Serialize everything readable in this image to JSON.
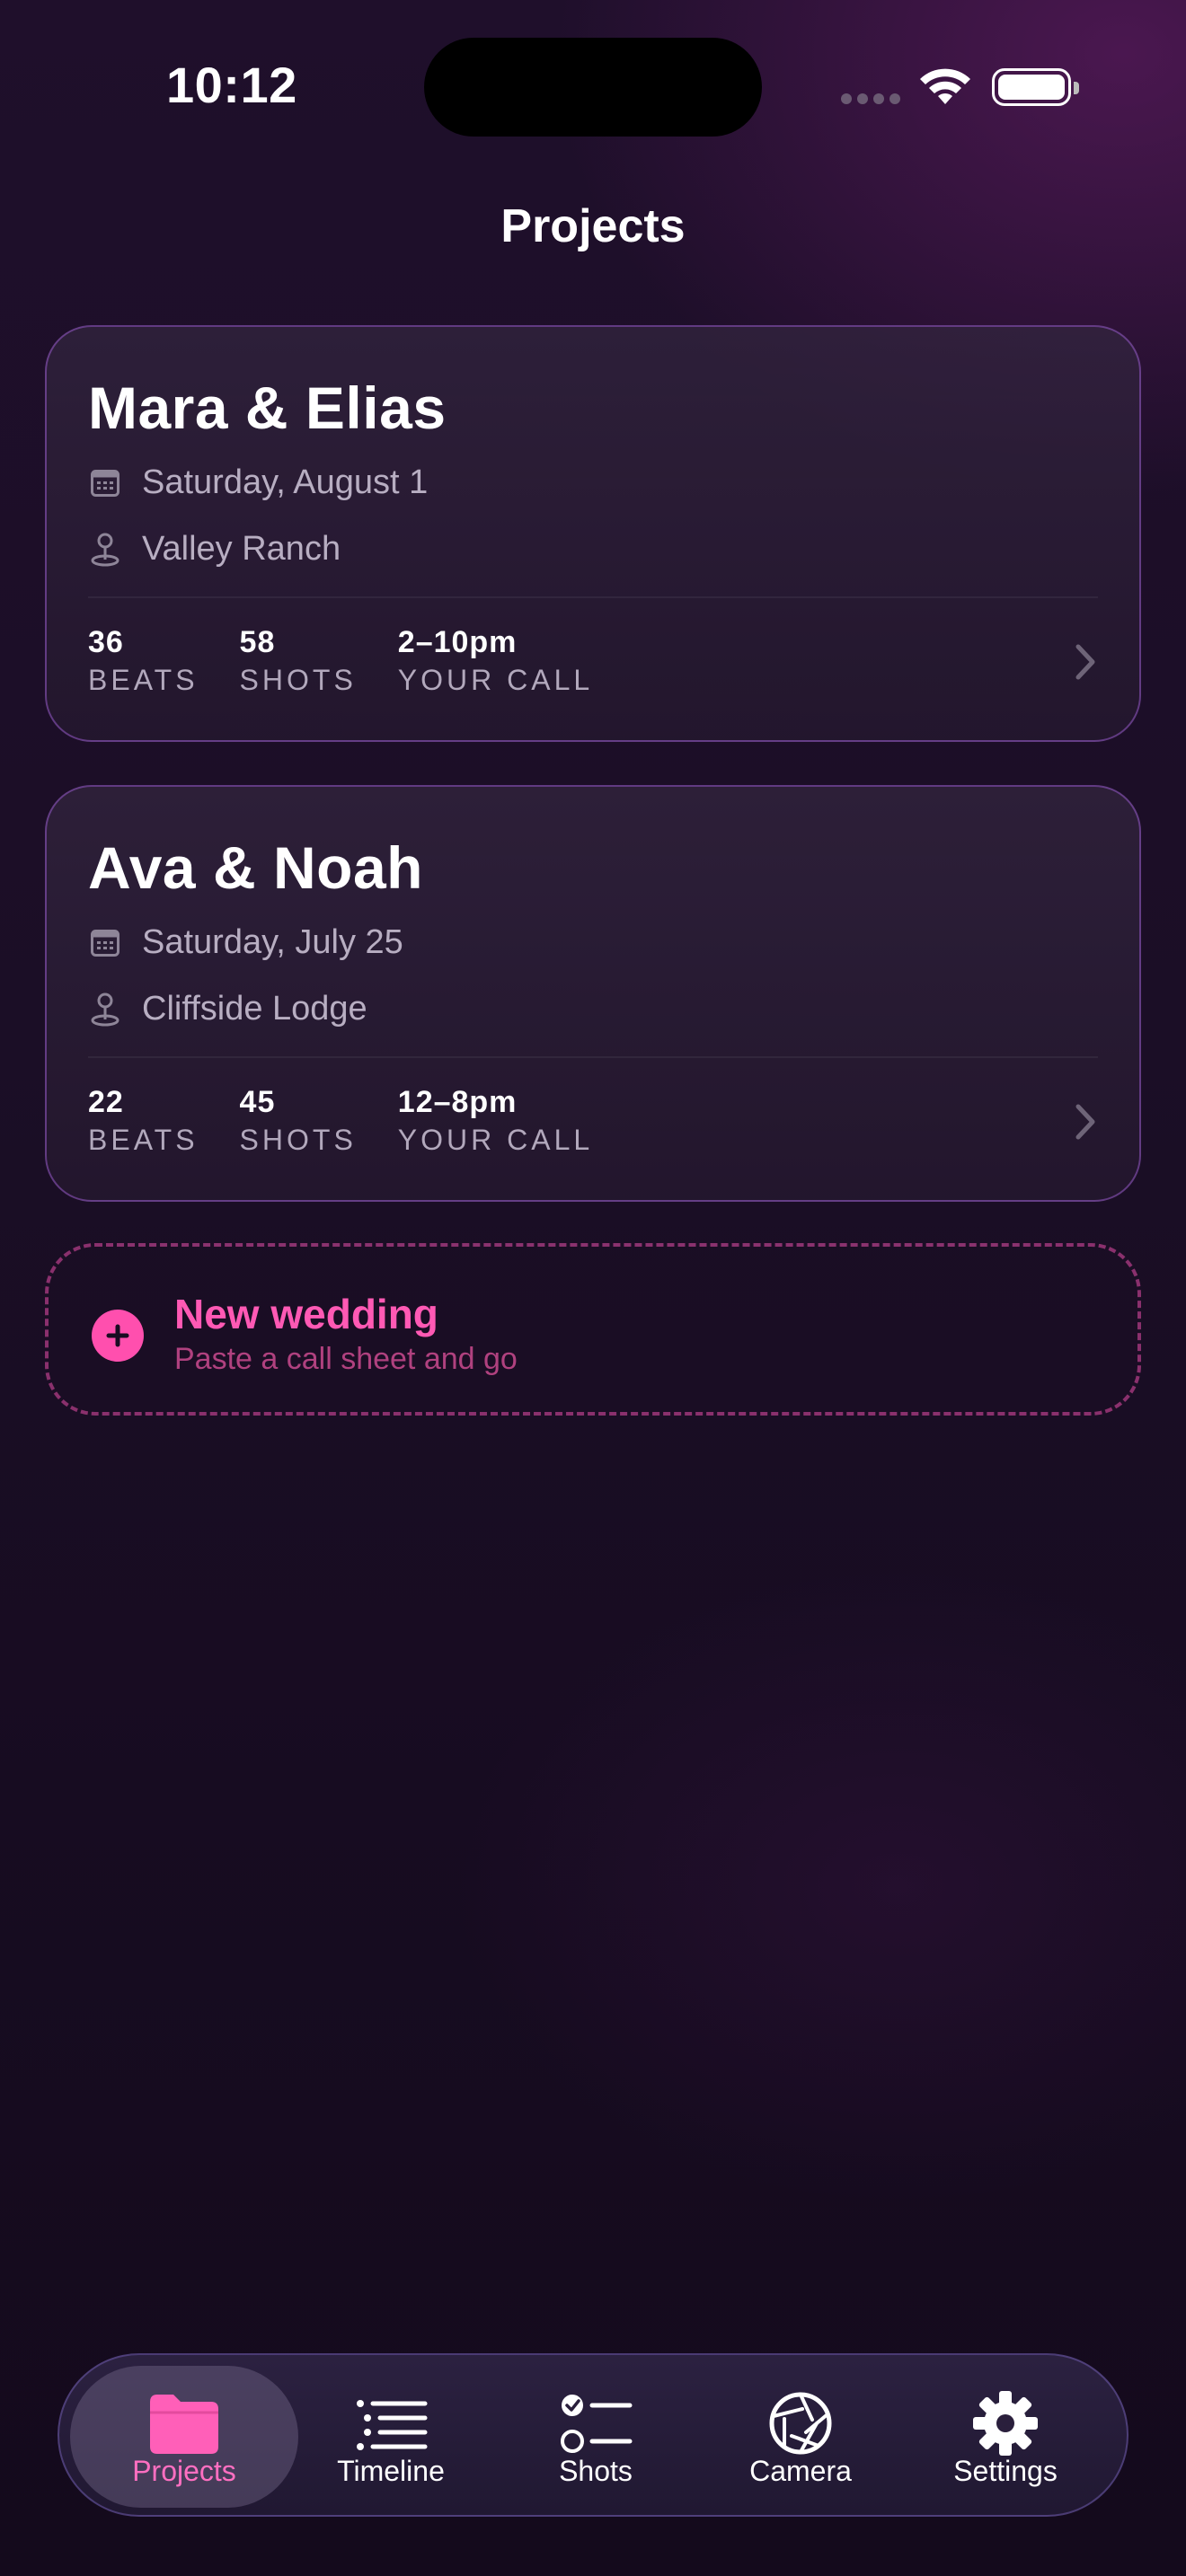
{
  "status_bar": {
    "time": "10:12"
  },
  "page": {
    "title": "Projects"
  },
  "projects": [
    {
      "title": "Mara & Elias",
      "date": "Saturday, August 1",
      "location": "Valley Ranch",
      "stats": [
        {
          "value": "36",
          "label": "BEATS"
        },
        {
          "value": "58",
          "label": "SHOTS"
        },
        {
          "value": "2–10pm",
          "label": "YOUR CALL"
        }
      ]
    },
    {
      "title": "Ava & Noah",
      "date": "Saturday, July 25",
      "location": "Cliffside Lodge",
      "stats": [
        {
          "value": "22",
          "label": "BEATS"
        },
        {
          "value": "45",
          "label": "SHOTS"
        },
        {
          "value": "12–8pm",
          "label": "YOUR CALL"
        }
      ]
    }
  ],
  "new_wedding": {
    "title": "New wedding",
    "subtitle": "Paste a call sheet and go"
  },
  "tab_bar": {
    "active": "Projects",
    "tabs": [
      {
        "label": "Projects",
        "icon": "folder-icon"
      },
      {
        "label": "Timeline",
        "icon": "list-icon"
      },
      {
        "label": "Shots",
        "icon": "checklist-icon"
      },
      {
        "label": "Camera",
        "icon": "aperture-icon"
      },
      {
        "label": "Settings",
        "icon": "gear-icon"
      }
    ]
  },
  "colors": {
    "accent": "#ff4fae",
    "background": "#1b0e26",
    "card_border": "#8a5ab8"
  }
}
